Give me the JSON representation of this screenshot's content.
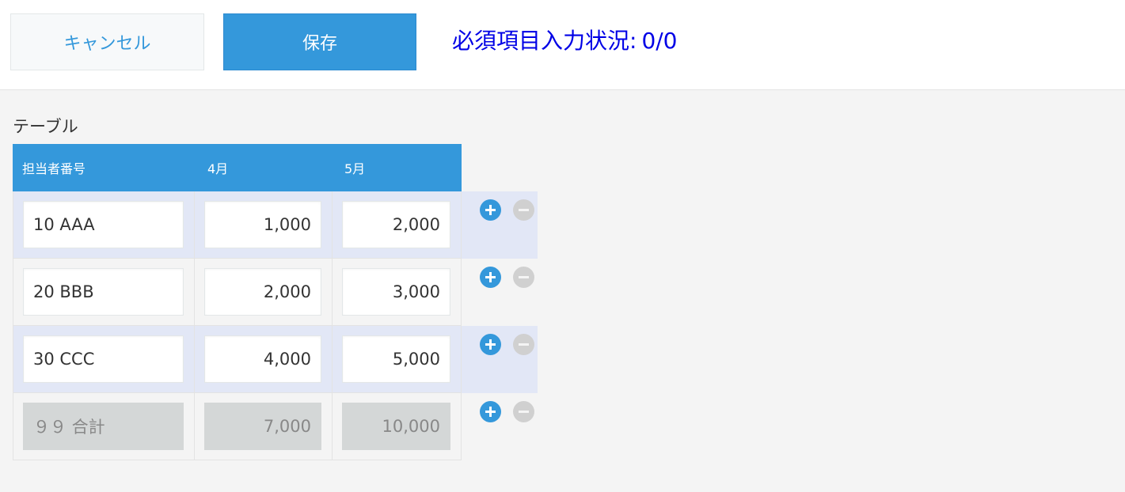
{
  "toolbar": {
    "cancel_label": "キャンセル",
    "save_label": "保存",
    "required_status_label": "必須項目入力状況:",
    "required_status_value": "0/0"
  },
  "table": {
    "label": "テーブル",
    "columns": [
      "担当者番号",
      "4月",
      "5月"
    ],
    "rows": [
      {
        "staff": "10 AAA",
        "apr": "1,000",
        "may": "2,000",
        "readonly": false
      },
      {
        "staff": "20 BBB",
        "apr": "2,000",
        "may": "3,000",
        "readonly": false
      },
      {
        "staff": "30 CCC",
        "apr": "4,000",
        "may": "5,000",
        "readonly": false
      },
      {
        "staff": "９９ 合計",
        "apr": "7,000",
        "may": "10,000",
        "readonly": true
      }
    ]
  },
  "colors": {
    "accent": "#3498db",
    "status_text": "#0000e6",
    "row_highlight": "#e2e7f6",
    "readonly_field": "#d4d7d7"
  },
  "icons": {
    "add": "plus-circle-icon",
    "remove": "minus-circle-icon"
  }
}
